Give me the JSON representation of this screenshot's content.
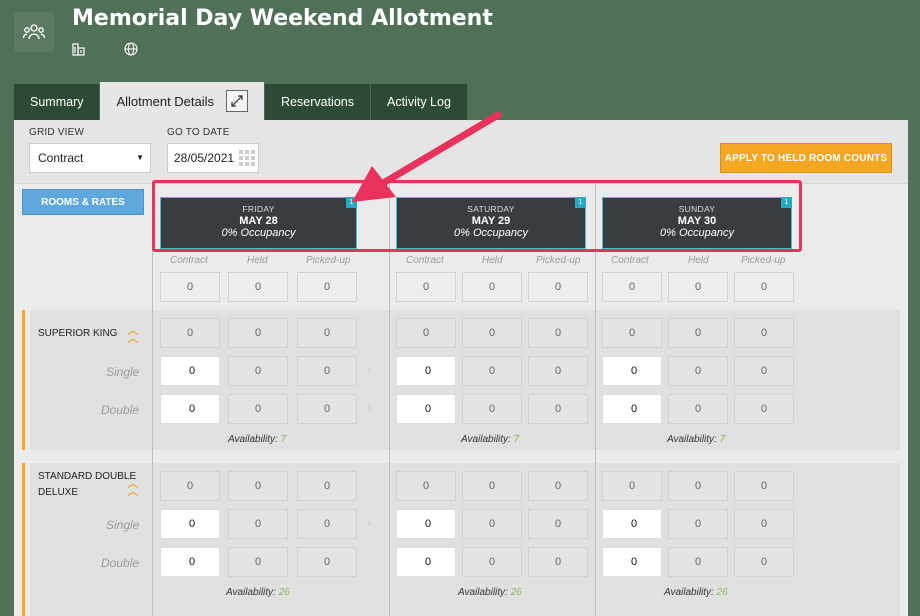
{
  "header": {
    "title": "Memorial Day Weekend Allotment",
    "app_icon": "group-icon",
    "icons": [
      "building-icon",
      "globe-icon"
    ]
  },
  "tabs": [
    {
      "label": "Summary",
      "active": false
    },
    {
      "label": "Allotment Details",
      "active": true
    },
    {
      "label": "Reservations",
      "active": false
    },
    {
      "label": "Activity Log",
      "active": false
    }
  ],
  "toolbar": {
    "grid_view_label": "GRID VIEW",
    "grid_view_value": "Contract",
    "goto_date_label": "GO TO DATE",
    "goto_date_value": "28/05/2021",
    "apply_button": "APPLY TO HELD ROOM COUNTS"
  },
  "rooms_rates_button": "ROOMS & RATES",
  "column_headers": [
    "Contract",
    "Held",
    "Picked-up"
  ],
  "days": [
    {
      "name": "FRIDAY",
      "date": "MAY 28",
      "occupancy": "0% Occupancy",
      "badge": "1"
    },
    {
      "name": "SATURDAY",
      "date": "MAY 29",
      "occupancy": "0% Occupancy",
      "badge": "1"
    },
    {
      "name": "SUNDAY",
      "date": "MAY 30",
      "occupancy": "0% Occupancy",
      "badge": "1"
    }
  ],
  "totals_row": [
    "0",
    "0",
    "0"
  ],
  "room_types": [
    {
      "name_lines": [
        "SUPERIOR KING"
      ],
      "summary": [
        "0",
        "0",
        "0"
      ],
      "rows": [
        {
          "label": "Single",
          "values": [
            "0",
            "0",
            "0"
          ]
        },
        {
          "label": "Double",
          "values": [
            "0",
            "0",
            "0"
          ]
        }
      ],
      "availability_label": "Availability:",
      "availability": "7"
    },
    {
      "name_lines": [
        "STANDARD DOUBLE",
        "DELUXE"
      ],
      "summary": [
        "0",
        "0",
        "0"
      ],
      "rows": [
        {
          "label": "Single",
          "values": [
            "0",
            "0",
            "0"
          ]
        },
        {
          "label": "Double",
          "values": [
            "0",
            "0",
            "0"
          ]
        }
      ],
      "availability_label": "Availability:",
      "availability": "26"
    }
  ],
  "colors": {
    "accent_orange": "#f5a623",
    "button_blue": "#5fa8de",
    "header_dark": "#3a3d40",
    "teal_border": "#40c2cf",
    "annotation": "#e8325b",
    "availability_green": "#8bb85c"
  }
}
